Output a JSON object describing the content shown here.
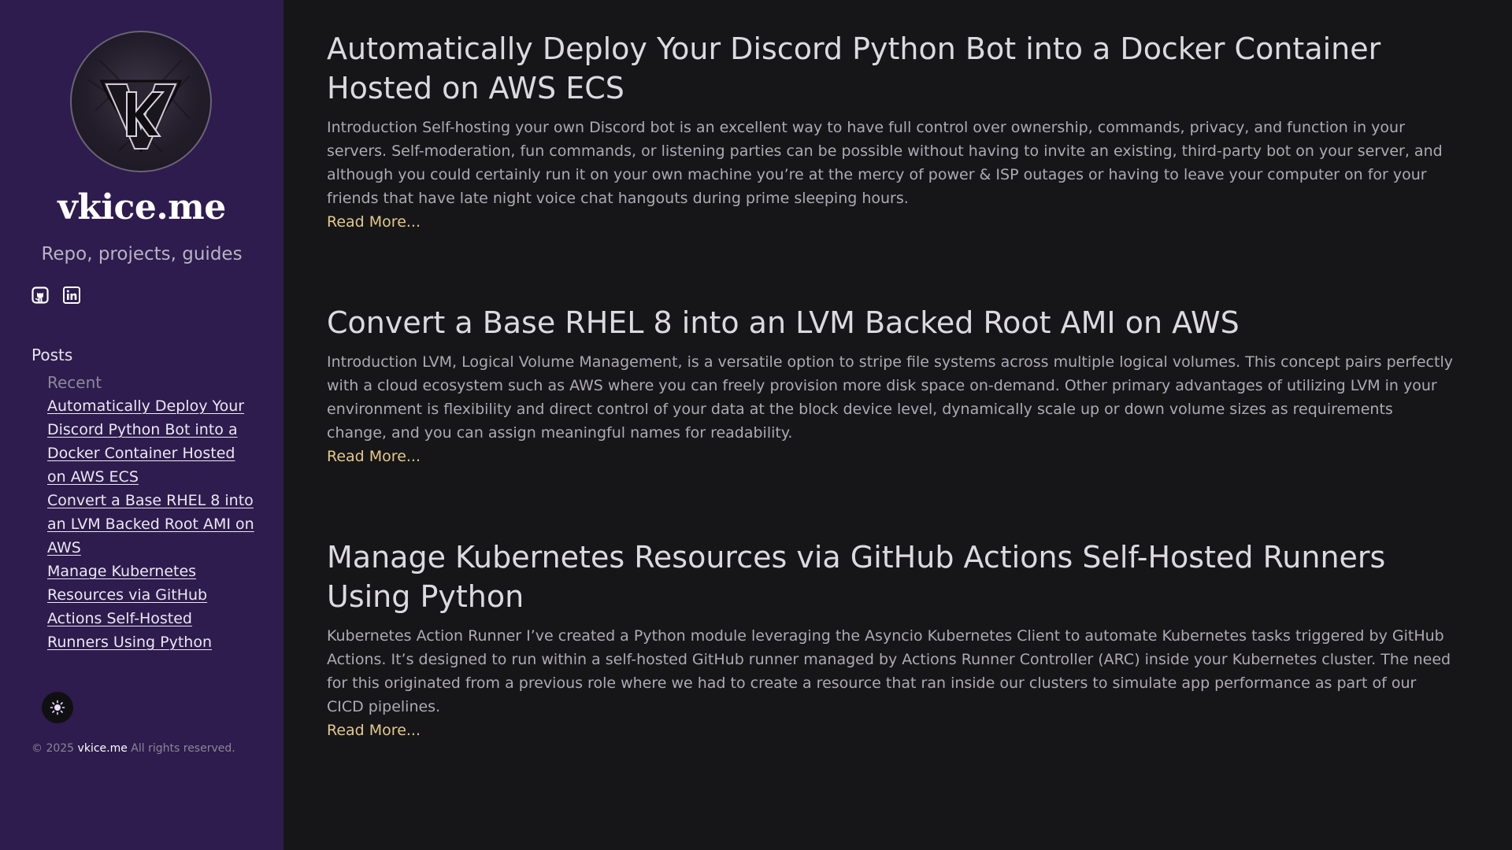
{
  "site": {
    "title": "vkice.me",
    "tagline": "Repo, projects, guides"
  },
  "sidebar": {
    "social_icons": [
      "github-icon",
      "linkedin-icon"
    ],
    "nav": {
      "heading": "Posts",
      "subheading": "Recent",
      "items": [
        {
          "label": "Automatically Deploy Your Discord Python Bot into a Docker Container Hosted on AWS ECS"
        },
        {
          "label": "Convert a Base RHEL 8 into an LVM Backed Root AMI on AWS"
        },
        {
          "label": "Manage Kubernetes Resources via GitHub Actions Self-Hosted Runners Using Python"
        }
      ]
    },
    "theme_toggle_icon": "sun-icon",
    "footer": {
      "prefix": "© 2025",
      "site_link": "vkice.me",
      "suffix": "All rights reserved."
    }
  },
  "posts": [
    {
      "title": "Automatically Deploy Your Discord Python Bot into a Docker Container Hosted on AWS ECS",
      "excerpt": "Introduction Self-hosting your own Discord bot is an excellent way to have full control over ownership, commands, privacy, and function in your servers. Self-moderation, fun commands, or listening parties can be possible without having to invite an existing, third-party bot on your server, and although you could certainly run it on your own machine you’re at the mercy of power & ISP outages or having to leave your computer on for your friends that have late night voice chat hangouts during prime sleeping hours.",
      "read_more": "Read More..."
    },
    {
      "title": "Convert a Base RHEL 8 into an LVM Backed Root AMI on AWS",
      "excerpt": "Introduction LVM, Logical Volume Management, is a versatile option to stripe file systems across multiple logical volumes. This concept pairs perfectly with a cloud ecosystem such as AWS where you can freely provision more disk space on-demand. Other primary advantages of utilizing LVM in your environment is flexibility and direct control of your data at the block device level, dynamically scale up or down volume sizes as requirements change, and you can assign meaningful names for readability.",
      "read_more": "Read More..."
    },
    {
      "title": "Manage Kubernetes Resources via GitHub Actions Self-Hosted Runners Using Python",
      "excerpt": "Kubernetes Action Runner I’ve created a Python module leveraging the Asyncio Kubernetes Client to automate Kubernetes tasks triggered by GitHub Actions. It’s designed to run within a self-hosted GitHub runner managed by Actions Runner Controller (ARC) inside your Kubernetes cluster. The need for this originated from a previous role where we had to create a resource that ran inside our clusters to simulate app performance as part of our CICD pipelines.",
      "read_more": "Read More..."
    }
  ],
  "colors": {
    "sidebar_bg": "#2d1c4d",
    "main_bg": "#161618",
    "accent": "#e3c98a"
  }
}
